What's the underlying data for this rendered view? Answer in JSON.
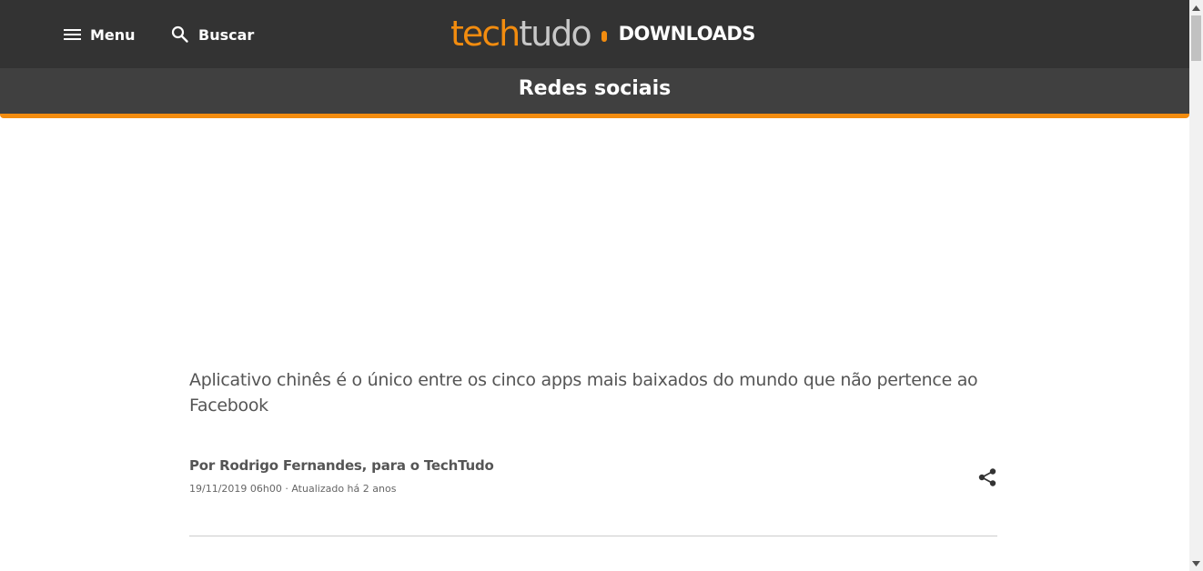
{
  "header": {
    "menu_label": "Menu",
    "search_label": "Buscar",
    "logo": {
      "part1": "tech",
      "part2": "tudo",
      "section": "DOWNLOADS"
    }
  },
  "section": {
    "title": "Redes sociais"
  },
  "article": {
    "subtitle": "Aplicativo chinês é o único entre os cinco apps mais baixados do mundo que não pertence ao Facebook",
    "author": "Por Rodrigo Fernandes, para o TechTudo",
    "dateline": "19/11/2019 06h00 · Atualizado há 2 anos"
  },
  "colors": {
    "header_bg": "#333333",
    "section_bg": "#404040",
    "accent": "#f28c0f"
  },
  "icons": {
    "menu": "menu-icon",
    "search": "search-icon",
    "share": "share-icon"
  }
}
